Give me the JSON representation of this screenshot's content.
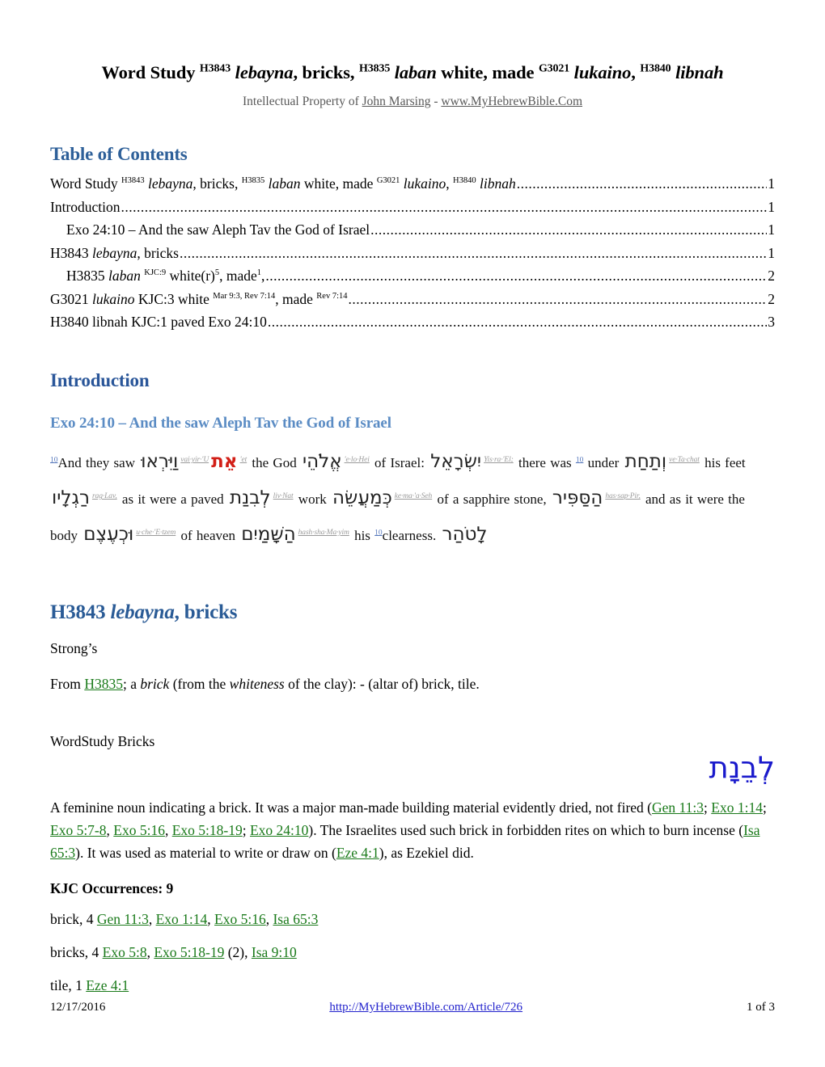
{
  "document": {
    "title_parts": [
      {
        "text": "Word Study ",
        "style": "bold"
      },
      {
        "text": "H3843",
        "style": "sup"
      },
      {
        "text": " lebayna",
        "style": "italic"
      },
      {
        "text": ", bricks, ",
        "style": "bold"
      },
      {
        "text": "H3835",
        "style": "sup"
      },
      {
        "text": " laban",
        "style": "italic"
      },
      {
        "text": " white, made ",
        "style": "bold"
      },
      {
        "text": "G3021",
        "style": "sup"
      },
      {
        "text": " lukaino",
        "style": "italic"
      },
      {
        "text": ", ",
        "style": "bold"
      },
      {
        "text": "H3840",
        "style": "sup"
      },
      {
        "text": " libnah",
        "style": "italic"
      }
    ],
    "subtitle_prefix": "Intellectual Property of ",
    "subtitle_author": "John Marsing",
    "subtitle_sep": " - ",
    "subtitle_site": "www.MyHebrewBible.Com"
  },
  "toc": {
    "heading": "Table of Contents",
    "entries": [
      {
        "id": "toc-1",
        "page": "1",
        "indent": false,
        "parts": [
          {
            "text": "Word Study ",
            "style": "normal"
          },
          {
            "text": "H3843",
            "style": "sup"
          },
          {
            "text": " lebayna",
            "style": "italic"
          },
          {
            "text": ", bricks, ",
            "style": "normal"
          },
          {
            "text": "H3835",
            "style": "sup"
          },
          {
            "text": " laban",
            "style": "italic"
          },
          {
            "text": " white, made ",
            "style": "normal"
          },
          {
            "text": "G3021",
            "style": "sup"
          },
          {
            "text": " lukaino",
            "style": "italic"
          },
          {
            "text": ", ",
            "style": "normal"
          },
          {
            "text": "H3840",
            "style": "sup"
          },
          {
            "text": " libnah",
            "style": "italic"
          }
        ]
      },
      {
        "id": "toc-2",
        "page": "1",
        "indent": false,
        "parts": [
          {
            "text": "Introduction",
            "style": "normal"
          }
        ]
      },
      {
        "id": "toc-3",
        "page": "1",
        "indent": true,
        "parts": [
          {
            "text": "Exo 24:10 – And the saw Aleph Tav the God of Israel",
            "style": "normal"
          }
        ]
      },
      {
        "id": "toc-4",
        "page": "1",
        "indent": false,
        "parts": [
          {
            "text": "H3843 ",
            "style": "normal"
          },
          {
            "text": "lebayna",
            "style": "italic"
          },
          {
            "text": ",  bricks",
            "style": "normal"
          }
        ]
      },
      {
        "id": "toc-5",
        "page": "2",
        "indent": true,
        "parts": [
          {
            "text": "H3835  ",
            "style": "normal"
          },
          {
            "text": "laban",
            "style": "italic"
          },
          {
            "text": " ",
            "style": "normal"
          },
          {
            "text": "KJC:9",
            "style": "sup"
          },
          {
            "text": " white(r)",
            "style": "normal"
          },
          {
            "text": "5",
            "style": "sup"
          },
          {
            "text": ", made",
            "style": "normal"
          },
          {
            "text": "1",
            "style": "sup"
          },
          {
            "text": ",",
            "style": "normal"
          }
        ]
      },
      {
        "id": "toc-6",
        "page": "2",
        "indent": false,
        "parts": [
          {
            "text": "G3021 ",
            "style": "normal"
          },
          {
            "text": "lukaino",
            "style": "italic"
          },
          {
            "text": " KJC:3 white ",
            "style": "normal"
          },
          {
            "text": "Mar 9:3, Rev 7:14",
            "style": "sup"
          },
          {
            "text": ", made ",
            "style": "normal"
          },
          {
            "text": "Rev 7:14",
            "style": "sup"
          }
        ]
      },
      {
        "id": "toc-7",
        "page": "3",
        "indent": false,
        "parts": [
          {
            "text": "H3840 libnah KJC:1 paved Exo 24:10",
            "style": "normal"
          }
        ]
      }
    ]
  },
  "introduction": {
    "heading": "Introduction",
    "subheading": "Exo 24:10 – And the saw Aleph Tav the God of Israel",
    "interlinear": [
      {
        "kind": "vnum",
        "text": "10"
      },
      {
        "kind": "en",
        "text": "And they saw "
      },
      {
        "kind": "heb",
        "text": "וַיִּרְאוּ"
      },
      {
        "kind": "translit",
        "text": "vai·yir·'U"
      },
      {
        "kind": "heb-red",
        "text": "אֵת"
      },
      {
        "kind": "translit",
        "text": "'et"
      },
      {
        "kind": "en",
        "text": " the God "
      },
      {
        "kind": "heb",
        "text": "אֱלֹהֵי"
      },
      {
        "kind": "translit",
        "text": "'e·lo·Hei"
      },
      {
        "kind": "en",
        "text": " of Israel: "
      },
      {
        "kind": "heb",
        "text": "יִשְׂרָאֵל"
      },
      {
        "kind": "translit",
        "text": "Yis·ra·'El;"
      },
      {
        "kind": "en",
        "text": " there was "
      },
      {
        "kind": "vnum",
        "text": "10"
      },
      {
        "kind": "en",
        "text": " under "
      },
      {
        "kind": "heb",
        "text": "וְתַחַת"
      },
      {
        "kind": "translit",
        "text": "ve·Ta·chat"
      },
      {
        "kind": "en",
        "text": " his feet "
      },
      {
        "kind": "heb",
        "text": "רַגְלָיו"
      },
      {
        "kind": "translit",
        "text": "rag·Lav,"
      },
      {
        "kind": "en",
        "text": " as it were a paved "
      },
      {
        "kind": "heb",
        "text": "לְבִנַת"
      },
      {
        "kind": "translit",
        "text": "liv·Nat"
      },
      {
        "kind": "en",
        "text": " work "
      },
      {
        "kind": "heb",
        "text": "כְּמַעֲשֵׂה"
      },
      {
        "kind": "translit",
        "text": "ke·ma·'a·Seh"
      },
      {
        "kind": "en",
        "text": " of a sapphire stone, "
      },
      {
        "kind": "heb",
        "text": "הַסַּפִּיר"
      },
      {
        "kind": "translit",
        "text": "has·sap·Pir,"
      },
      {
        "kind": "en",
        "text": " and as it were the body "
      },
      {
        "kind": "heb",
        "text": "וּכְעֶצֶם"
      },
      {
        "kind": "translit",
        "text": "u·che·'E·tzem"
      },
      {
        "kind": "en",
        "text": " of heaven "
      },
      {
        "kind": "heb",
        "text": "הַשָּׁמַיִם"
      },
      {
        "kind": "translit",
        "text": "hash·sha·Ma·yim"
      },
      {
        "kind": "en",
        "text": " his "
      },
      {
        "kind": "vnum",
        "text": "10"
      },
      {
        "kind": "en",
        "text": "clearness. "
      },
      {
        "kind": "heb",
        "text": "לָטֹהַר"
      }
    ]
  },
  "h3843": {
    "heading_parts": [
      {
        "text": "H3843 ",
        "style": "normal"
      },
      {
        "text": "lebayna",
        "style": "italic"
      },
      {
        "text": ",  bricks",
        "style": "normal"
      }
    ],
    "strongs_label": "Strong’s",
    "strongs_def_parts": [
      {
        "text": "From ",
        "style": "normal"
      },
      {
        "text": "H3835",
        "style": "glink"
      },
      {
        "text": "; a ",
        "style": "normal"
      },
      {
        "text": "brick",
        "style": "italic"
      },
      {
        "text": " (from the ",
        "style": "normal"
      },
      {
        "text": "whiteness",
        "style": "italic"
      },
      {
        "text": " of the clay): - (altar of) brick, tile.",
        "style": "normal"
      }
    ],
    "wordstudy_label": "WordStudy Bricks",
    "wordstudy_hebrew": "לְבֵנָת",
    "description_parts": [
      {
        "text": "A feminine noun indicating a brick. It was a major man-made building material evidently dried, not fired (",
        "style": "normal"
      },
      {
        "text": "Gen 11:3",
        "style": "glink"
      },
      {
        "text": "; ",
        "style": "normal"
      },
      {
        "text": "Exo 1:14",
        "style": "glink"
      },
      {
        "text": "; ",
        "style": "normal"
      },
      {
        "text": "Exo 5:7-8",
        "style": "glink"
      },
      {
        "text": ", ",
        "style": "normal"
      },
      {
        "text": "Exo 5:16",
        "style": "glink"
      },
      {
        "text": ", ",
        "style": "normal"
      },
      {
        "text": "Exo 5:18-19",
        "style": "glink"
      },
      {
        "text": "; ",
        "style": "normal"
      },
      {
        "text": "Exo 24:10",
        "style": "glink"
      },
      {
        "text": "). The Israelites used such brick in forbidden rites on which to burn incense (",
        "style": "normal"
      },
      {
        "text": "Isa 65:3",
        "style": "glink"
      },
      {
        "text": "). It was used as material to write or draw on (",
        "style": "normal"
      },
      {
        "text": "Eze 4:1",
        "style": "glink"
      },
      {
        "text": "), as Ezekiel did.",
        "style": "normal"
      }
    ],
    "kjc_heading": "KJC Occurrences: 9",
    "occurrences": [
      {
        "parts": [
          {
            "text": "brick, 4 ",
            "style": "normal"
          },
          {
            "text": "Gen 11:3",
            "style": "glink"
          },
          {
            "text": ", ",
            "style": "normal"
          },
          {
            "text": "Exo 1:14",
            "style": "glink"
          },
          {
            "text": ", ",
            "style": "normal"
          },
          {
            "text": "Exo 5:16",
            "style": "glink"
          },
          {
            "text": ", ",
            "style": "normal"
          },
          {
            "text": "Isa 65:3",
            "style": "glink"
          }
        ]
      },
      {
        "parts": [
          {
            "text": "bricks, 4 ",
            "style": "normal"
          },
          {
            "text": "Exo 5:8",
            "style": "glink"
          },
          {
            "text": ", ",
            "style": "normal"
          },
          {
            "text": "Exo 5:18-19",
            "style": "glink"
          },
          {
            "text": " (2), ",
            "style": "normal"
          },
          {
            "text": "Isa 9:10",
            "style": "glink"
          }
        ]
      },
      {
        "parts": [
          {
            "text": "tile, 1 ",
            "style": "normal"
          },
          {
            "text": "Eze 4:1",
            "style": "glink"
          }
        ]
      }
    ]
  },
  "footer": {
    "date": "12/17/2016",
    "url": "http://MyHebrewBible.com/Article/726",
    "page_label": "1 of 3"
  },
  "colors": {
    "heading_blue": "#2e6099",
    "subheading_blue": "#5b8cc4",
    "link_green": "#1a7a1a",
    "link_blue": "#2222cc",
    "hebrew_blue": "#1a1acc",
    "hebrew_red": "#d21f17",
    "translit_gray": "#9a9a9a"
  }
}
